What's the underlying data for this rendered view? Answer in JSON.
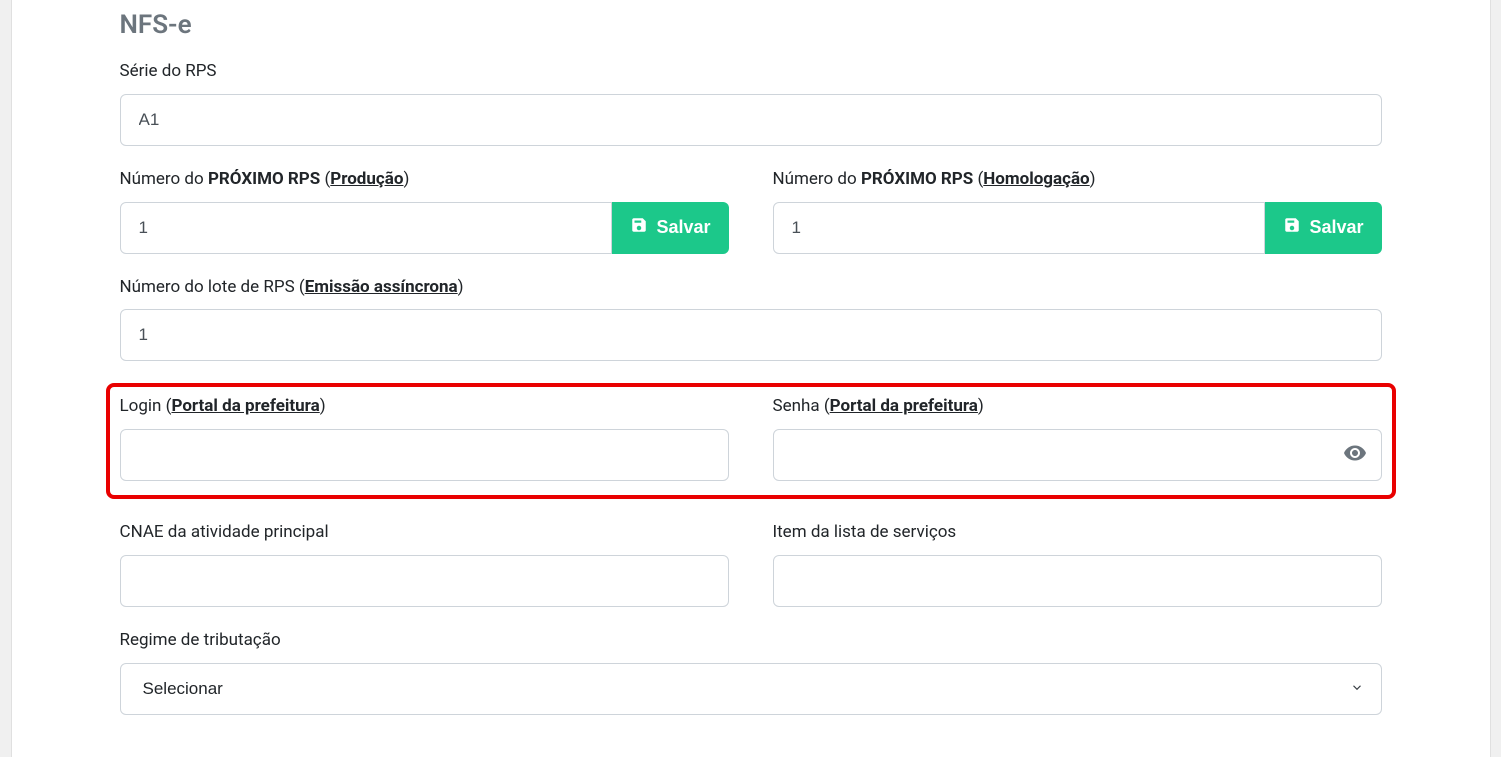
{
  "section": {
    "title": "NFS-e"
  },
  "fields": {
    "serie_rps": {
      "label": "Série do RPS",
      "value": "A1"
    },
    "proximo_rps_producao": {
      "label_prefix": "Número do ",
      "label_bold": "PRÓXIMO RPS",
      "label_open": " (",
      "label_link": "Produção",
      "label_close": ")",
      "value": "1",
      "button": "Salvar"
    },
    "proximo_rps_homolog": {
      "label_prefix": "Número do ",
      "label_bold": "PRÓXIMO RPS",
      "label_open": " (",
      "label_link": "Homologação",
      "label_close": ")",
      "value": "1",
      "button": "Salvar"
    },
    "lote_rps": {
      "label_prefix": "Número do lote de RPS (",
      "label_link": "Emissão assíncrona",
      "label_close": ")",
      "value": "1"
    },
    "login_portal": {
      "label_prefix": "Login (",
      "label_link": "Portal da prefeitura",
      "label_close": ")",
      "value": ""
    },
    "senha_portal": {
      "label_prefix": "Senha (",
      "label_link": "Portal da prefeitura",
      "label_close": ")",
      "value": ""
    },
    "cnae": {
      "label": "CNAE da atividade principal",
      "value": ""
    },
    "item_lista": {
      "label": "Item da lista de serviços",
      "value": ""
    },
    "regime_tributacao": {
      "label": "Regime de tributação",
      "selected": "Selecionar"
    }
  }
}
